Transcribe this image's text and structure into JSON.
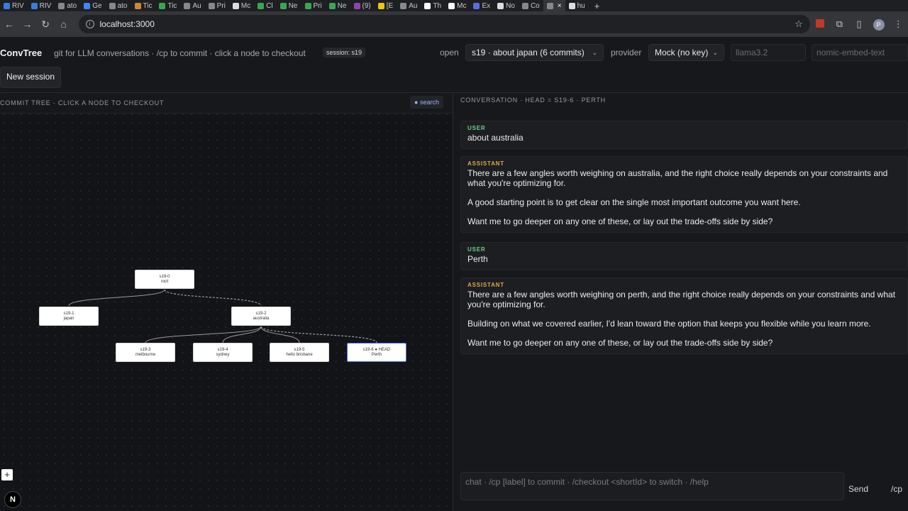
{
  "browser": {
    "tabs": [
      {
        "label": "RIV",
        "color": "#3b7be0"
      },
      {
        "label": "RIV",
        "color": "#3b7be0"
      },
      {
        "label": "ato",
        "color": "#888888"
      },
      {
        "label": "Ge",
        "color": "#4285f4"
      },
      {
        "label": "ato",
        "color": "#888888"
      },
      {
        "label": "Tic",
        "color": "#c88a3a"
      },
      {
        "label": "Tic",
        "color": "#3aa655"
      },
      {
        "label": "Au",
        "color": "#888888"
      },
      {
        "label": "Pri",
        "color": "#888888"
      },
      {
        "label": "Mc",
        "color": "#dddddd"
      },
      {
        "label": "Cl",
        "color": "#3aa655"
      },
      {
        "label": "Ne",
        "color": "#3aa655"
      },
      {
        "label": "Pri",
        "color": "#3aa655"
      },
      {
        "label": "Ne",
        "color": "#3aa655"
      },
      {
        "label": "(9)",
        "color": "#8e44ad"
      },
      {
        "label": "[E",
        "color": "#f1c40f"
      },
      {
        "label": "Au",
        "color": "#888888"
      },
      {
        "label": "Th",
        "color": "#ffffff"
      },
      {
        "label": "Mc",
        "color": "#ffffff"
      },
      {
        "label": "Ex",
        "color": "#5b6ee1"
      },
      {
        "label": "No",
        "color": "#dddddd"
      },
      {
        "label": "Co",
        "color": "#888888"
      },
      {
        "label": "",
        "color": "#888888",
        "active": true
      },
      {
        "label": "hu",
        "color": "#dddddd"
      }
    ],
    "url": "localhost:3000"
  },
  "header": {
    "brand": "ConvTree",
    "tagline": "git for LLM conversations · /cp to commit · click a node to checkout",
    "session_badge": "session: s19",
    "open_label": "open",
    "open_value": "s19 · about japan (6 commits)",
    "provider_label": "provider",
    "provider_value": "Mock (no key)",
    "model_placeholder": "llama3.2",
    "embed_placeholder": "nomic-embed-text",
    "new_session": "New session"
  },
  "tree": {
    "title": "COMMIT TREE · CLICK A NODE TO CHECKOUT",
    "search_label": "search",
    "nodes": [
      {
        "id": "s19-0",
        "label": "root"
      },
      {
        "id": "s19-1",
        "label": "japan"
      },
      {
        "id": "s19-2",
        "label": "australia"
      },
      {
        "id": "s19-3",
        "label": "melbourne"
      },
      {
        "id": "s19-4",
        "label": "sydney"
      },
      {
        "id": "s19-5",
        "label": "hello brisbane"
      },
      {
        "id": "s19-6 ● HEAD",
        "label": "Perth"
      }
    ],
    "zoom_in": "+",
    "next_badge": "N"
  },
  "conversation": {
    "title": "CONVERSATION · HEAD = S19-6 · PERTH",
    "messages": [
      {
        "role": "USER",
        "paras": [
          "about australia"
        ]
      },
      {
        "role": "ASSISTANT",
        "paras": [
          "There are a few angles worth weighing on australia, and the right choice really depends on your constraints and what you're optimizing for.",
          "A good starting point is to get clear on the single most important outcome you want here.",
          "Want me to go deeper on any one of these, or lay out the trade-offs side by side?"
        ]
      },
      {
        "role": "USER",
        "paras": [
          "Perth"
        ]
      },
      {
        "role": "ASSISTANT",
        "paras": [
          "There are a few angles worth weighing on perth, and the right choice really depends on your constraints and what you're optimizing for.",
          "Building on what we covered earlier, I'd lean toward the option that keeps you flexible while you learn more.",
          "Want me to go deeper on any one of these, or lay out the trade-offs side by side?"
        ]
      }
    ],
    "composer_placeholder": "chat · /cp [label] to commit · /checkout <shortId> to switch · /help",
    "send_label": "Send",
    "cp_label": "/cp"
  }
}
